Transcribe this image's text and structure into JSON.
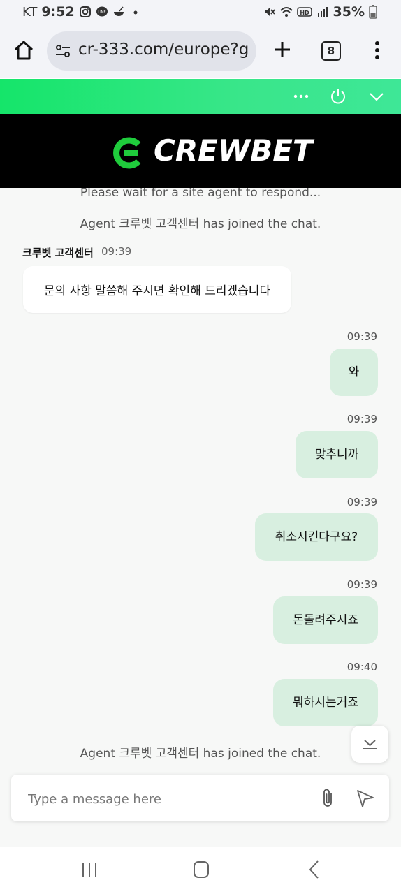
{
  "status_bar": {
    "carrier": "KT",
    "time": "9:52",
    "battery": "35%",
    "icons": [
      "instagram-icon",
      "line-icon",
      "bowl-icon",
      "dot-icon",
      "mute-icon",
      "wifi-icon",
      "hd-icon",
      "signal-icon",
      "battery-icon"
    ]
  },
  "browser": {
    "url": "cr-333.com/europe?gam",
    "tab_count": "8"
  },
  "widget": {
    "brand": "CREWBET",
    "accent_color": "#1fe27a"
  },
  "chat": {
    "system_wait": "Please wait for a site agent to respond...",
    "system_joined_1": "Agent 크루벳 고객센터 has joined the chat.",
    "agent_name": "크루벳 고객센터",
    "agent_time": "09:39",
    "agent_message": "문의 사항 말씀해 주시면 확인해 드리겠습니다",
    "user_messages": [
      {
        "time": "09:39",
        "text": "와"
      },
      {
        "time": "09:39",
        "text": "맞추니까"
      },
      {
        "time": "09:39",
        "text": "취소시킨다구요?"
      },
      {
        "time": "09:39",
        "text": "돈돌려주시죠"
      },
      {
        "time": "09:40",
        "text": "뭐하시는거죠"
      }
    ],
    "system_joined_2": "Agent 크루벳 고객센터 has joined the chat."
  },
  "input": {
    "placeholder": "Type a message here"
  }
}
